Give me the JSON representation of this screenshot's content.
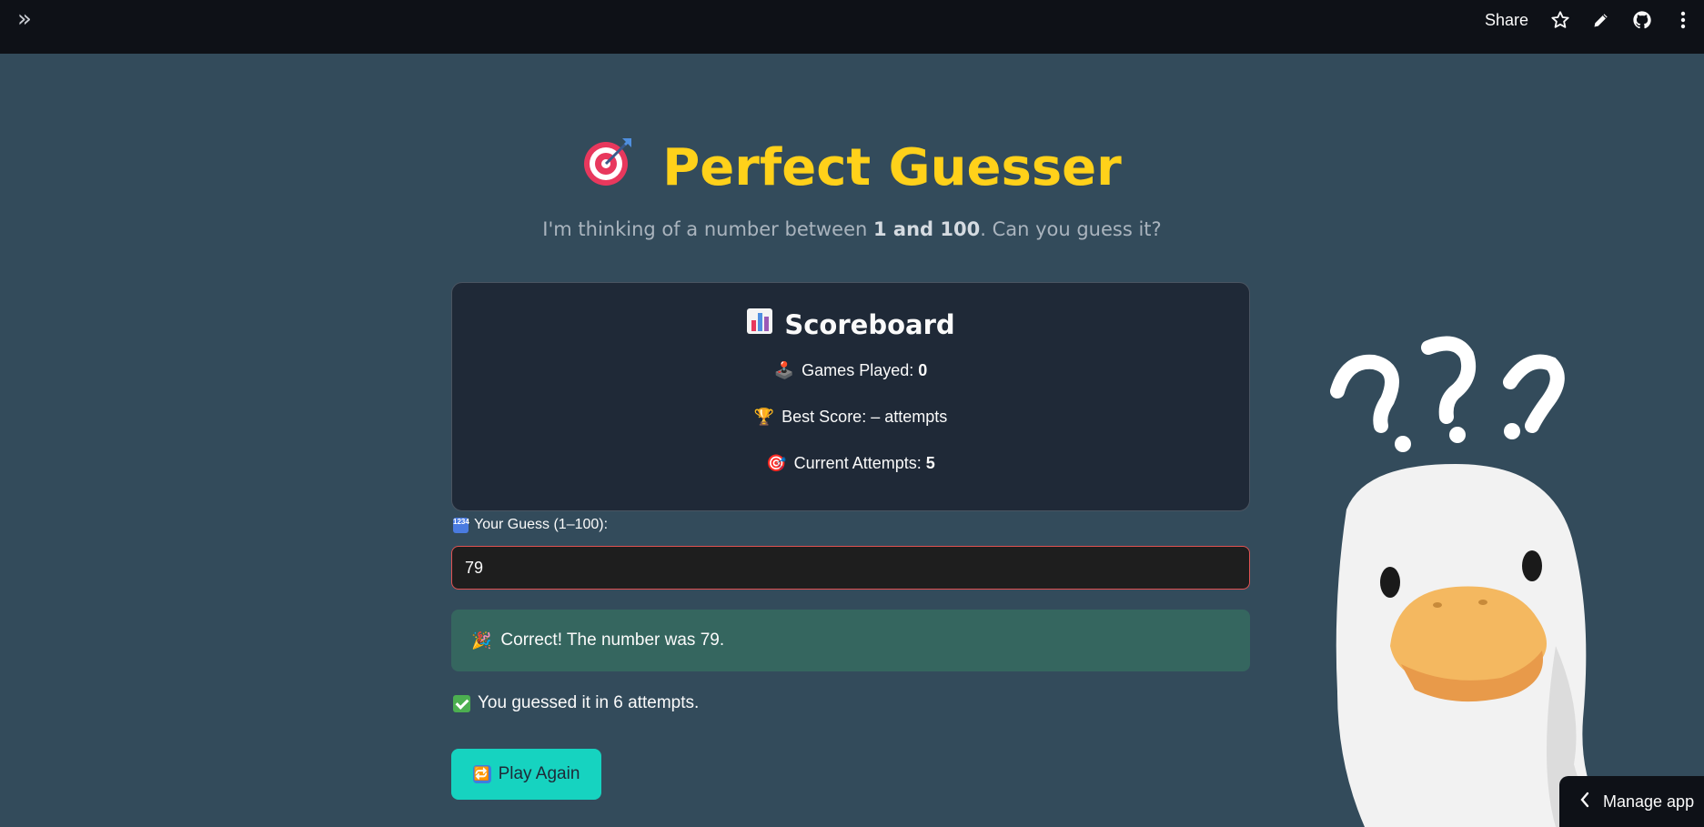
{
  "topbar": {
    "share_label": "Share",
    "icons": [
      "expand-sidebar-icon",
      "star-icon",
      "edit-icon",
      "github-icon",
      "more-vertical-icon"
    ]
  },
  "header": {
    "title_emoji": "🎯",
    "title": "Perfect Guesser",
    "subtitle_pre": "I'm thinking of a number between ",
    "subtitle_bold": "1 and 100",
    "subtitle_post": ". Can you guess it?"
  },
  "scoreboard": {
    "icon": "📊",
    "title": "Scoreboard",
    "games_played_icon": "🕹️",
    "games_played_label": "Games Played: ",
    "games_played_value": "0",
    "best_score_icon": "🏆",
    "best_score_text": "Best Score: – attempts",
    "current_attempts_icon": "🎯",
    "current_attempts_label": "Current Attempts: ",
    "current_attempts_value": "5"
  },
  "guess": {
    "label": "Your Guess (1–100):",
    "badge_text": "1234",
    "value": "79"
  },
  "result": {
    "icon": "🎉",
    "message": "Correct! The number was 79.",
    "attempts_message": "You guessed it in 6 attempts."
  },
  "play_again": {
    "icon": "🔁",
    "label": "Play Again"
  },
  "manage_app": {
    "label": "Manage app"
  },
  "colors": {
    "background": "#334b5b",
    "topbar": "#0e1117",
    "title": "#ffd11a",
    "scoreboard_bg": "#1f2937",
    "success_bg": "#35665f",
    "button_bg": "#16d3c0",
    "input_border": "#e05252"
  }
}
